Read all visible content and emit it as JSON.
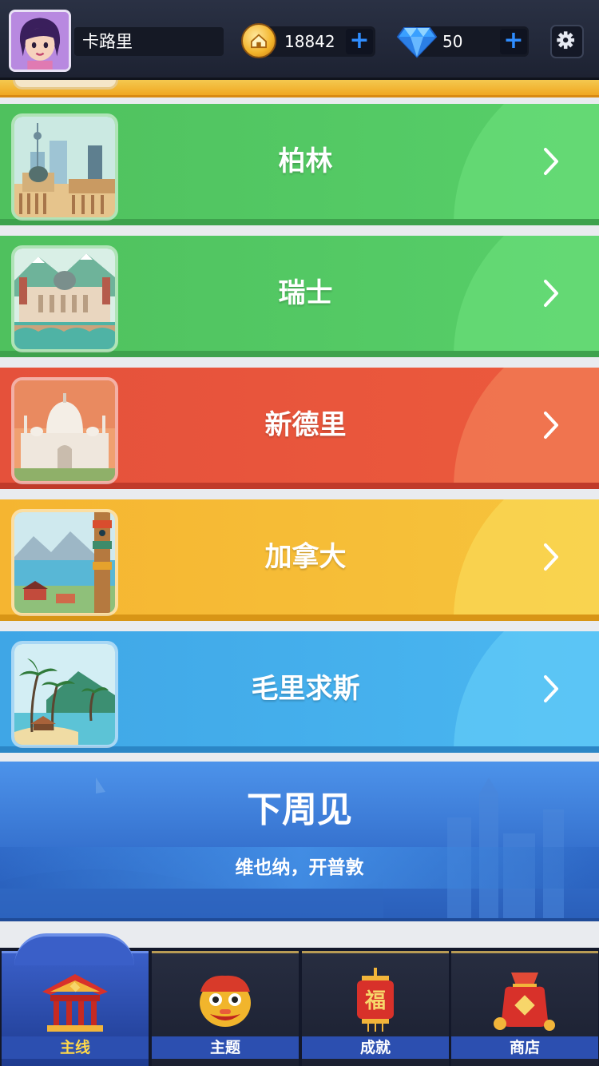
{
  "header": {
    "username": "卡路里",
    "coins": "18842",
    "gems": "50"
  },
  "levels": [
    {
      "name": "柏林",
      "theme": "green"
    },
    {
      "name": "瑞士",
      "theme": "green"
    },
    {
      "name": "新德里",
      "theme": "red"
    },
    {
      "name": "加拿大",
      "theme": "yellow"
    },
    {
      "name": "毛里求斯",
      "theme": "blue"
    }
  ],
  "coming_soon": {
    "title": "下周见",
    "subtitle": "维也纳，开普敦"
  },
  "nav": {
    "active": "main",
    "tabs": [
      {
        "id": "main",
        "label": "主线",
        "icon": "pavilion-icon"
      },
      {
        "id": "theme",
        "label": "主题",
        "icon": "lion-dance-icon"
      },
      {
        "id": "achievement",
        "label": "成就",
        "icon": "fu-lantern-icon"
      },
      {
        "id": "shop",
        "label": "商店",
        "icon": "gift-bag-icon"
      }
    ]
  },
  "colors": {
    "green": "#4fc15e",
    "red": "#e5513b",
    "yellow": "#f5b531",
    "blue": "#3fa6e6",
    "plus": "#2f8dff"
  }
}
